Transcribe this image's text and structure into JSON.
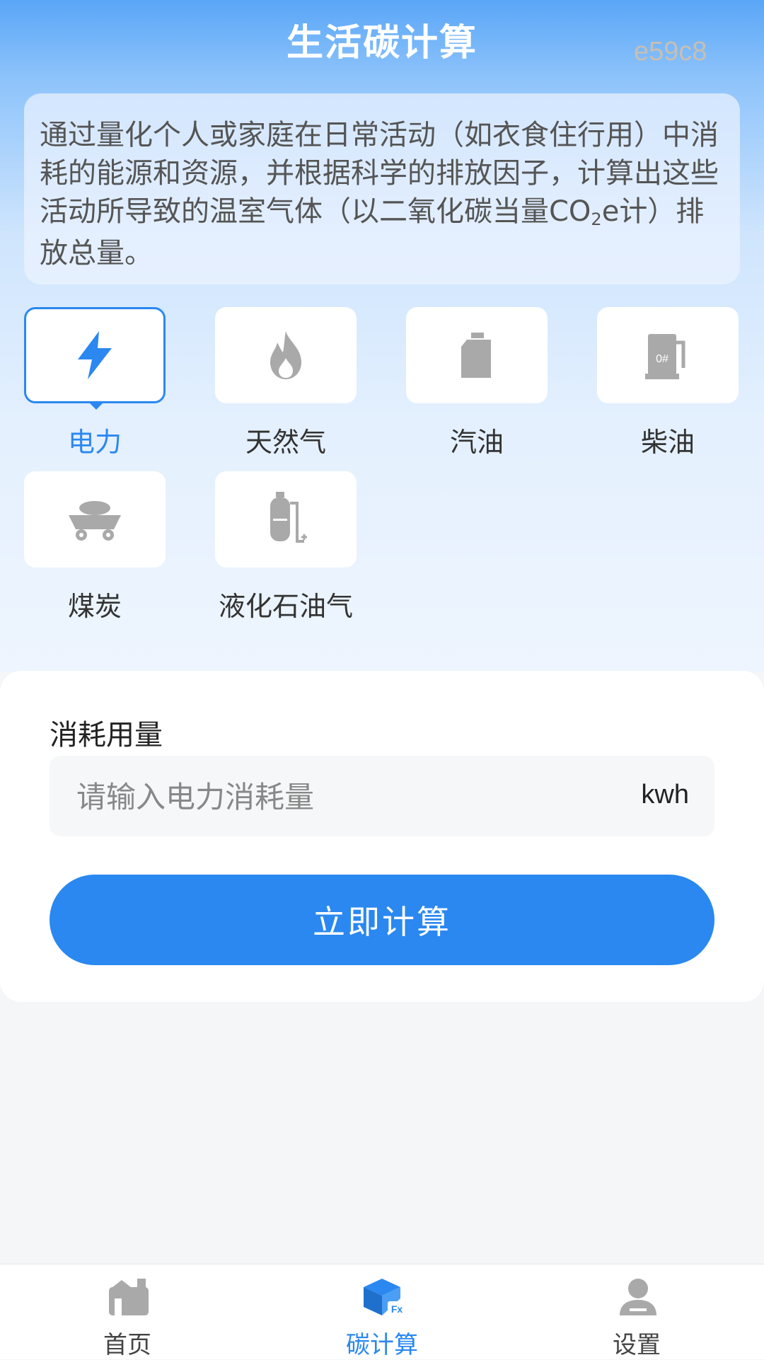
{
  "header": {
    "title": "生活碳计算",
    "watermark": "e59c8"
  },
  "description": {
    "text_before": "通过量化个人或家庭在日常活动（如衣食住行用）中消耗的能源和资源，并根据科学的排放因子，计算出这些活动所导致的温室气体（以二氧化碳当量CO",
    "subscript": "2",
    "text_after": "e计）排放总量。"
  },
  "categories": [
    {
      "label": "电力",
      "icon": "lightning-icon",
      "active": true
    },
    {
      "label": "天然气",
      "icon": "flame-icon",
      "active": false
    },
    {
      "label": "汽油",
      "icon": "fuel-can-icon",
      "active": false
    },
    {
      "label": "柴油",
      "icon": "fuel-pump-icon",
      "active": false
    },
    {
      "label": "煤炭",
      "icon": "coal-cart-icon",
      "active": false
    },
    {
      "label": "液化石油气",
      "icon": "gas-cylinder-icon",
      "active": false
    }
  ],
  "form": {
    "title": "消耗用量",
    "input_placeholder": "请输入电力消耗量",
    "input_value": "",
    "unit": "kwh",
    "button_label": "立即计算"
  },
  "nav": [
    {
      "label": "首页",
      "icon": "home-icon",
      "active": false
    },
    {
      "label": "碳计算",
      "icon": "carbon-calc-icon",
      "active": true
    },
    {
      "label": "设置",
      "icon": "user-icon",
      "active": false
    }
  ],
  "colors": {
    "accent": "#2a88f0",
    "icon_gray": "#a9a9a9",
    "pump_label": "0#"
  }
}
